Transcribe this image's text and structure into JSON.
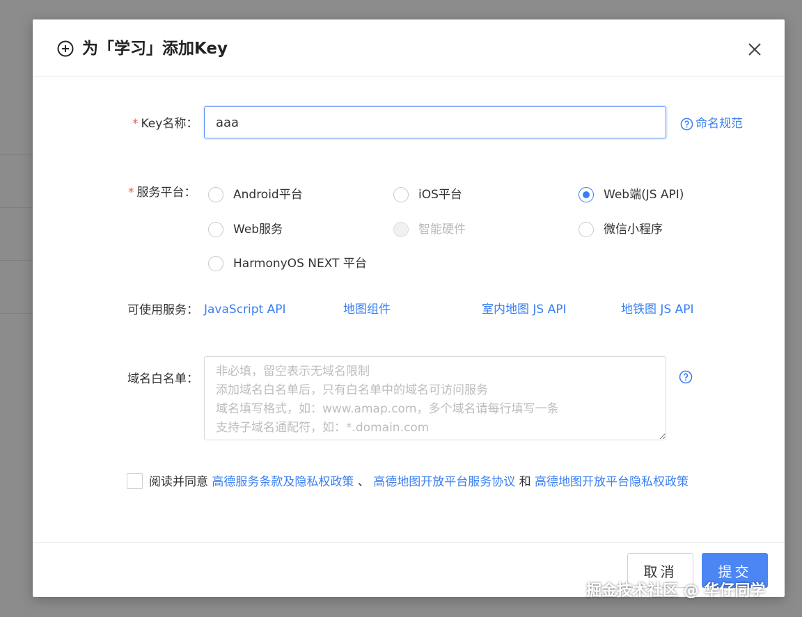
{
  "dialog": {
    "title": "为「学习」添加Key"
  },
  "form": {
    "key_name": {
      "label": "Key名称：",
      "value": "aaa",
      "help_link": "命名规范"
    },
    "platform": {
      "label": "服务平台：",
      "options": [
        {
          "label": "Android平台",
          "checked": false,
          "disabled": false
        },
        {
          "label": "iOS平台",
          "checked": false,
          "disabled": false
        },
        {
          "label": "Web端(JS API)",
          "checked": true,
          "disabled": false
        },
        {
          "label": "Web服务",
          "checked": false,
          "disabled": false
        },
        {
          "label": "智能硬件",
          "checked": false,
          "disabled": true
        },
        {
          "label": "微信小程序",
          "checked": false,
          "disabled": false
        },
        {
          "label": "HarmonyOS NEXT 平台",
          "checked": false,
          "disabled": false
        }
      ]
    },
    "services": {
      "label": "可使用服务：",
      "items": [
        "JavaScript API",
        "地图组件",
        "室内地图 JS API",
        "地铁图 JS API"
      ]
    },
    "whitelist": {
      "label": "域名白名单：",
      "placeholder": "非必填，留空表示无域名限制\n添加域名白名单后，只有白名单中的域名可访问服务\n域名填写格式，如：www.amap.com，多个域名请每行填写一条\n支持子域名通配符，如：*.domain.com",
      "value": ""
    },
    "agreement": {
      "prefix": "阅读并同意",
      "link1": "高德服务条款及隐私权政策",
      "sep1": "、",
      "link2": "高德地图开放平台服务协议",
      "sep2": "和",
      "link3": "高德地图开放平台隐私权政策",
      "checked": false
    }
  },
  "footer": {
    "cancel_label": "取消",
    "submit_label": "提交"
  },
  "watermark": "掘金技术社区 @ 华仔同学",
  "colors": {
    "primary": "#4c86f5",
    "link": "#3a7ff2",
    "required": "#f5573a",
    "overlay": "#8c8c8c"
  },
  "icons": {
    "header": "plus-circle-icon",
    "close": "close-icon",
    "help": "question-circle-icon"
  }
}
